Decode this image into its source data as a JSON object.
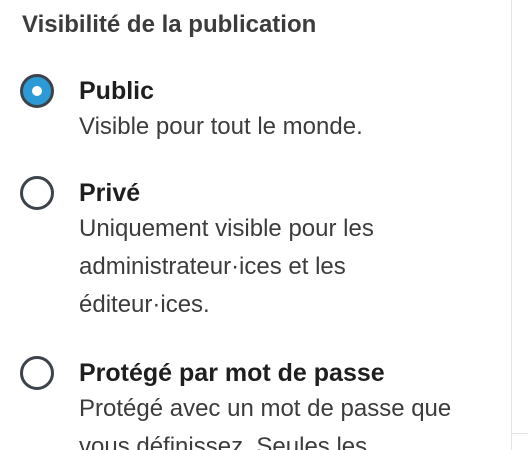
{
  "section": {
    "title": "Visibilité de la publication"
  },
  "options": [
    {
      "label": "Public",
      "description": "Visible pour tout le monde.",
      "selected": true
    },
    {
      "label": "Privé",
      "description": "Uniquement visible pour les administrateur·ices et les éditeur·ices.",
      "selected": false
    },
    {
      "label": "Protégé par mot de passe",
      "description": "Protégé avec un mot de passe que vous définissez. Seules les",
      "selected": false
    }
  ],
  "colors": {
    "radio_selected_fill": "#2b9ad6",
    "radio_border": "#3c434a",
    "text": "#1e1e1e"
  }
}
